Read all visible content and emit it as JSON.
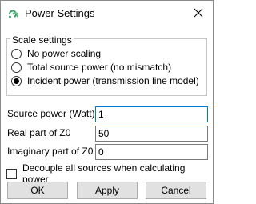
{
  "window": {
    "title": "Power Settings",
    "app_icon": "cst-logo-icon",
    "close_icon": "close-icon"
  },
  "scale_settings": {
    "title": "Scale settings",
    "options": [
      {
        "label": "No power scaling",
        "checked": false
      },
      {
        "label": "Total source power (no mismatch)",
        "checked": false
      },
      {
        "label": "Incident power (transmission line model)",
        "checked": true
      }
    ]
  },
  "fields": {
    "source_power": {
      "label": "Source power (Watt)",
      "value": "1"
    },
    "real_z0": {
      "label": "Real part of Z0",
      "value": "50"
    },
    "imag_z0": {
      "label": "Imaginary part of Z0",
      "value": "0"
    }
  },
  "decouple": {
    "label": "Decouple all sources when calculating power",
    "checked": false
  },
  "buttons": {
    "ok": "OK",
    "apply": "Apply",
    "cancel": "Cancel"
  },
  "colors": {
    "accent": "#0078d7",
    "logo_green": "#2e9d62"
  }
}
